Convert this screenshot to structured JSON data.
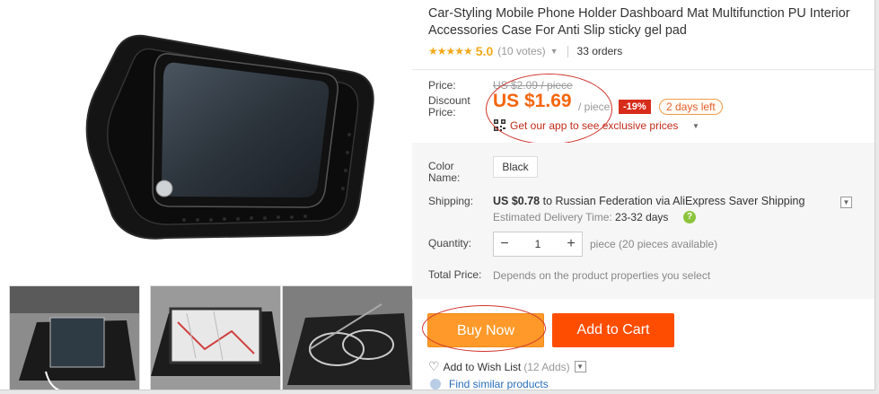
{
  "product": {
    "title": "Car-Styling Mobile Phone Holder Dashboard Mat Multifunction PU Interior Accessories Case For Anti Slip sticky gel pad",
    "stars": "★★★★★",
    "rating": "5.0",
    "votes": "(10 votes)",
    "orders": "33 orders"
  },
  "price": {
    "label": "Price:",
    "discount_label_1": "Discount",
    "discount_label_2": "Price:",
    "original": "US $2.09 / piece",
    "current": "US $1.69",
    "unit": "/ piece",
    "discount": "-19%",
    "days_left": "2 days left",
    "app_link": "Get our app to see exclusive prices"
  },
  "options": {
    "color_label_1": "Color",
    "color_label_2": "Name:",
    "color_value": "Black"
  },
  "shipping": {
    "label": "Shipping:",
    "cost": "US $0.78",
    "text": " to Russian Federation via AliExpress Saver Shipping",
    "delivery_label": "Estimated Delivery Time: ",
    "delivery_days": "23-32 days"
  },
  "quantity": {
    "label": "Quantity:",
    "value": "1",
    "minus": "−",
    "plus": "+",
    "note": "piece (20 pieces available)"
  },
  "total": {
    "label": "Total Price:",
    "note": "Depends on the product properties you select"
  },
  "actions": {
    "buy_now": "Buy Now",
    "add_to_cart": "Add to Cart",
    "wish_label": "Add to Wish List",
    "wish_count": "(12 Adds)",
    "similar": "Find similar products"
  },
  "colors": {
    "price_orange": "#f5650e",
    "buy_now_bg": "#ff9a2a",
    "add_to_cart_bg": "#ff4d00",
    "discount_bg": "#d72c1b",
    "annotation_red": "#d0342c"
  },
  "icons": {
    "rating": "star-icon",
    "dropdown": "chevron-down-icon",
    "qr": "qr-code-icon",
    "check": "check-circle-icon",
    "wish": "heart-icon"
  }
}
